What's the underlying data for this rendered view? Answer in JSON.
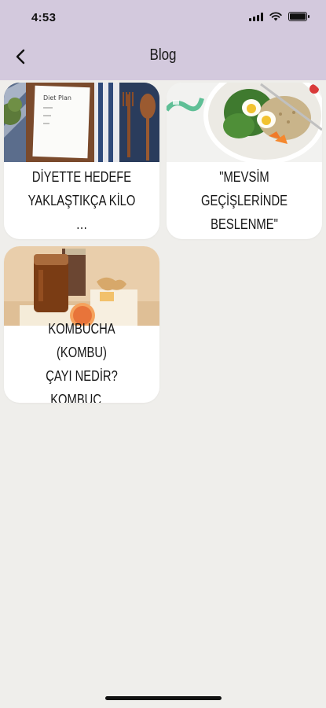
{
  "status_bar": {
    "time": "4:53"
  },
  "header": {
    "title": "Blog",
    "back_icon": "chevron-left-icon"
  },
  "posts": [
    {
      "title": "DİYETTE HEDEFE\nYAKLAŞTIKÇA KİLO …",
      "image": "diet-plan-notebook-photo"
    },
    {
      "title": "\"MEVSİM GEÇİŞLERİNDE\nBESLENME\"",
      "image": "salad-bowl-photo"
    },
    {
      "title": "KOMBUCHA (KOMBU)\nÇAYI NEDİR? KOMBUC…",
      "image": "kombucha-jar-photo"
    }
  ],
  "colors": {
    "header": "#d3c9dd",
    "background": "#efeeeb",
    "card": "#ffffff"
  }
}
